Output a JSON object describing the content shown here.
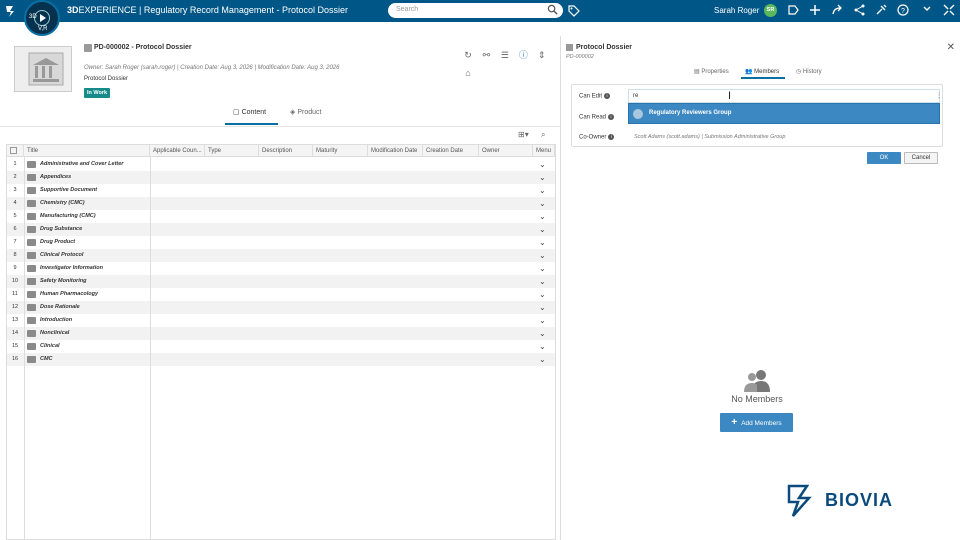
{
  "topbar": {
    "brand_bold": "3D",
    "brand_rest": "EXPERIENCE | Regulatory Record Management - Protocol Dossier",
    "search_placeholder": "Search",
    "user_name": "Sarah Roger",
    "avatar_initials": "SR",
    "compass_labels": [
      "3D",
      "V,R"
    ]
  },
  "object": {
    "title": "PD-000002 - Protocol Dossier",
    "meta": "Owner: Sarah Roger (sarah.roger)  |  Creation Date: Aug 3, 2026    |  Modification Date: Aug 3, 2026",
    "type": "Protocol Dossier",
    "status": "In Work"
  },
  "tabs": {
    "content": "Content",
    "product": "Product"
  },
  "grid": {
    "columns": [
      "Title",
      "Applicable Coun...",
      "Type",
      "Description",
      "Maturity",
      "Modification Date",
      "Creation Date",
      "Owner",
      "Menu"
    ],
    "rows": [
      {
        "n": "1",
        "title": "Administrative and Cover Letter"
      },
      {
        "n": "2",
        "title": "Appendices"
      },
      {
        "n": "3",
        "title": "Supportive Document"
      },
      {
        "n": "4",
        "title": "Chemistry (CMC)"
      },
      {
        "n": "5",
        "title": "Manufacturing (CMC)"
      },
      {
        "n": "6",
        "title": "Drug Substance"
      },
      {
        "n": "7",
        "title": "Drug Product"
      },
      {
        "n": "8",
        "title": "Clinical Protocol"
      },
      {
        "n": "9",
        "title": "Investigator Information"
      },
      {
        "n": "10",
        "title": "Safety Monitoring"
      },
      {
        "n": "11",
        "title": "Human Pharmacology"
      },
      {
        "n": "12",
        "title": "Dose Rationale"
      },
      {
        "n": "13",
        "title": "Introduction"
      },
      {
        "n": "14",
        "title": "Nonclinical"
      },
      {
        "n": "15",
        "title": "Clinical"
      },
      {
        "n": "16",
        "title": "CMC"
      }
    ]
  },
  "panel": {
    "title": "Protocol Dossier",
    "subtitle": "PD-000002",
    "tabs": {
      "properties": "Properties",
      "members": "Members",
      "history": "History"
    },
    "can_edit_label": "Can Edit",
    "can_read_label": "Can Read",
    "co_owner_label": "Co-Owner",
    "can_edit_value": "re",
    "dropdown_option": "Regulatory Reviewers Group",
    "co_owner_value": "Scott Adams (scott.adams) | Submission Administrative Group",
    "ok": "OK",
    "cancel": "Cancel",
    "no_members": "No Members",
    "add_members": "Add Members",
    "brand": "BIOVIA"
  },
  "colors": {
    "topbar": "#005686",
    "accent": "#3c88c2",
    "status": "#178a8a"
  }
}
